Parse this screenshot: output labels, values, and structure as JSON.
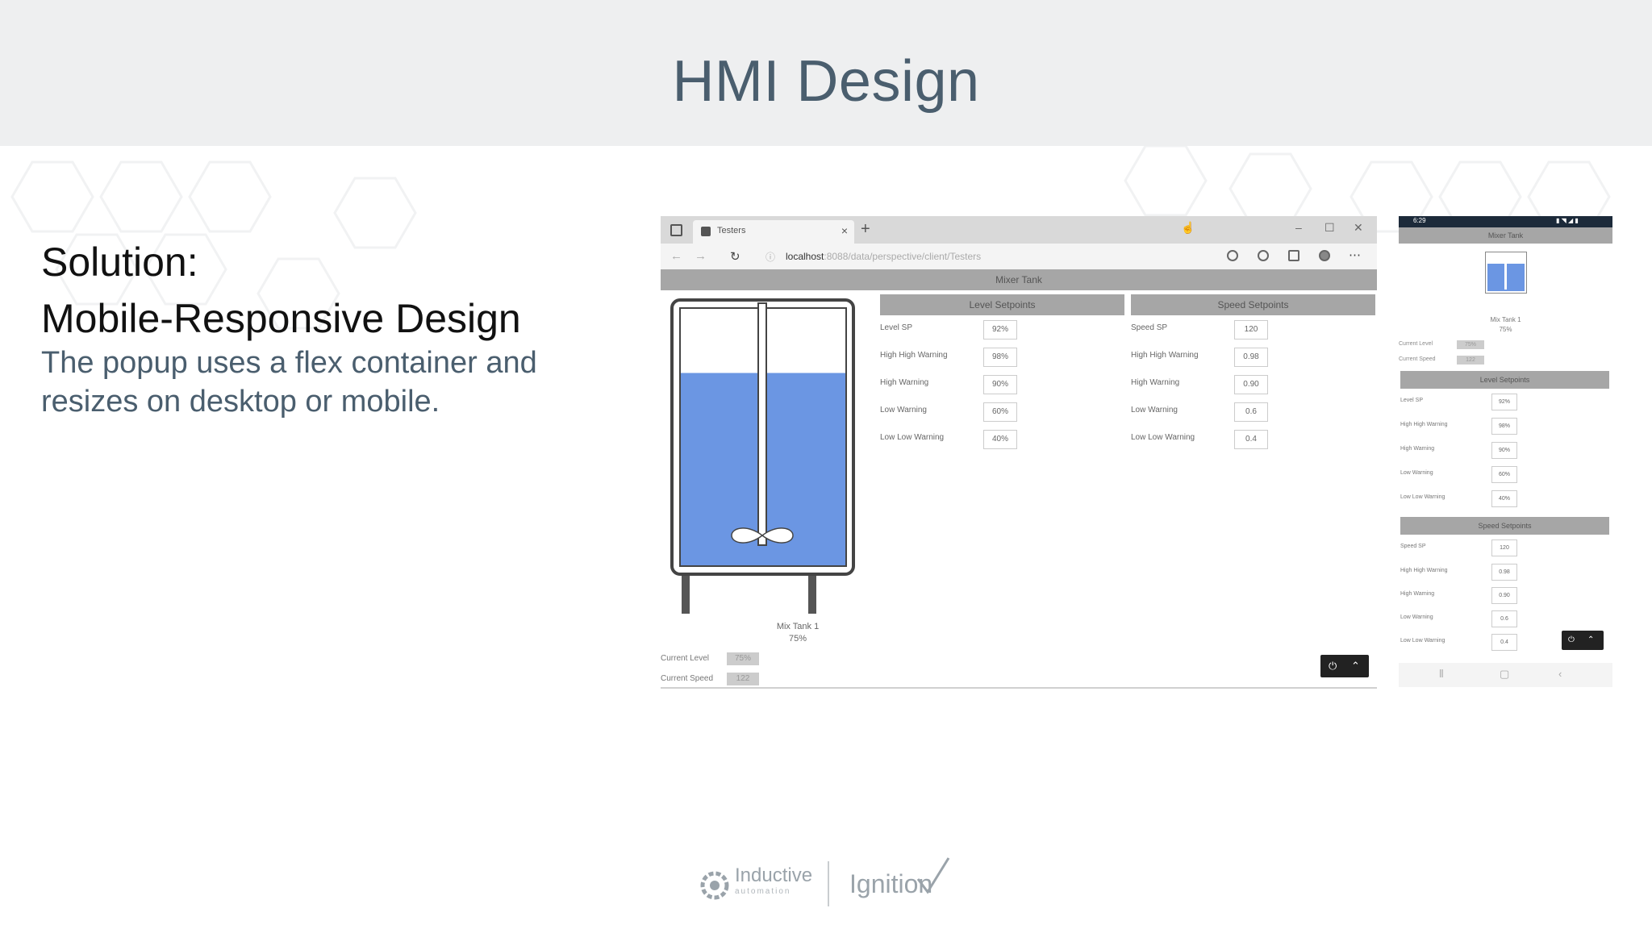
{
  "slide": {
    "title": "HMI Design",
    "heading_line1": "Solution:",
    "heading_line2": "Mobile-Responsive Design",
    "body": "The popup uses a flex container and resizes on desktop or mobile."
  },
  "desktop": {
    "tab_label": "Testers",
    "url_host": "localhost",
    "url_rest": ":8088/data/perspective/client/Testers",
    "app_title": "Mixer Tank",
    "tank_name": "Mix Tank 1",
    "tank_level": "75%",
    "fill_percent": 75,
    "current_level_label": "Current Level",
    "current_level_value": "75%",
    "current_speed_label": "Current Speed",
    "current_speed_value": "122",
    "level_setpoints": {
      "title": "Level Setpoints",
      "rows": [
        {
          "label": "Level SP",
          "value": "92%"
        },
        {
          "label": "High High Warning",
          "value": "98%"
        },
        {
          "label": "High Warning",
          "value": "90%"
        },
        {
          "label": "Low Warning",
          "value": "60%"
        },
        {
          "label": "Low Low Warning",
          "value": "40%"
        }
      ]
    },
    "speed_setpoints": {
      "title": "Speed Setpoints",
      "rows": [
        {
          "label": "Speed SP",
          "value": "120"
        },
        {
          "label": "High High Warning",
          "value": "0.98"
        },
        {
          "label": "High Warning",
          "value": "0.90"
        },
        {
          "label": "Low Warning",
          "value": "0.6"
        },
        {
          "label": "Low Low Warning",
          "value": "0.4"
        }
      ]
    }
  },
  "mobile": {
    "status_time": "6:29",
    "app_title": "Mixer Tank",
    "tank_name": "Mix Tank 1",
    "tank_level": "75%",
    "current_level_label": "Current Level",
    "current_level_value": "75%",
    "current_speed_label": "Current Speed",
    "current_speed_value": "122",
    "level_setpoints": {
      "title": "Level Setpoints",
      "rows": [
        {
          "label": "Level SP",
          "value": "92%"
        },
        {
          "label": "High High Warning",
          "value": "98%"
        },
        {
          "label": "High Warning",
          "value": "90%"
        },
        {
          "label": "Low Warning",
          "value": "60%"
        },
        {
          "label": "Low Low Warning",
          "value": "40%"
        }
      ]
    },
    "speed_setpoints": {
      "title": "Speed Setpoints",
      "rows": [
        {
          "label": "Speed SP",
          "value": "120"
        },
        {
          "label": "High High Warning",
          "value": "0.98"
        },
        {
          "label": "High Warning",
          "value": "0.90"
        },
        {
          "label": "Low Warning",
          "value": "0.6"
        },
        {
          "label": "Low Low Warning",
          "value": "0.4"
        }
      ]
    }
  },
  "footer": {
    "ia_name": "Inductive",
    "ia_sub": "automation",
    "ignition_name": "Ignition"
  },
  "colors": {
    "tank_fill": "#6b96e3",
    "header_bg": "#eeeff0",
    "title_color": "#4a5e6e",
    "panel_header": "#a6a6a6"
  }
}
